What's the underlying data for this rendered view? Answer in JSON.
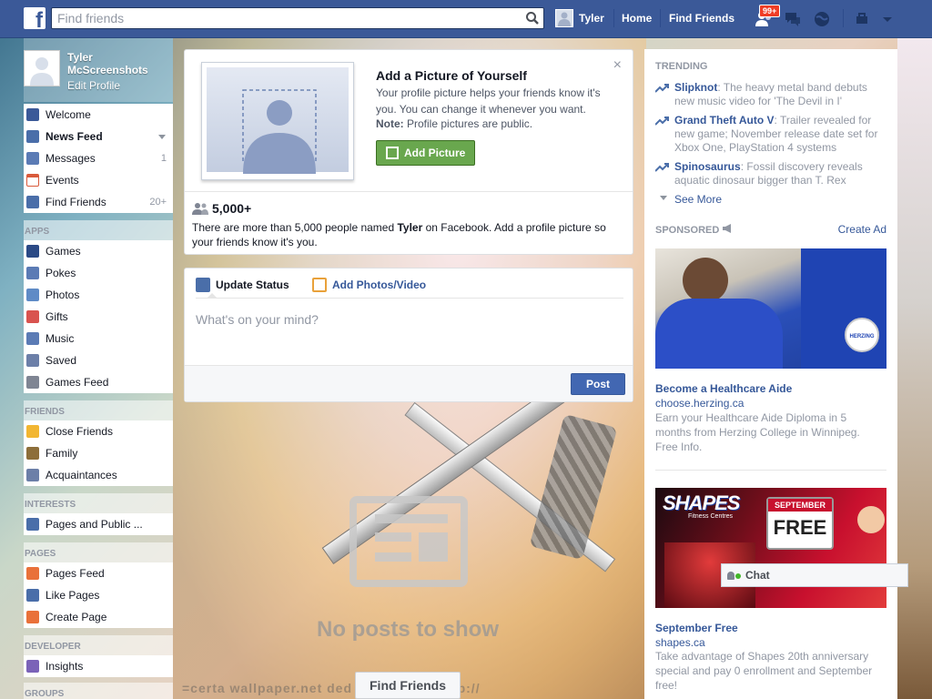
{
  "topbar": {
    "logo": "f",
    "search_placeholder": "Find friends",
    "user_name": "Tyler",
    "home": "Home",
    "find_friends": "Find Friends",
    "notification_count": "99+"
  },
  "profile": {
    "name": "Tyler McScreenshots",
    "edit": "Edit Profile"
  },
  "nav": {
    "main": [
      {
        "label": "Welcome",
        "icon": "facebook-icon",
        "color": "#3b5998"
      },
      {
        "label": "News Feed",
        "icon": "news-feed-icon",
        "color": "#4a6ea9"
      },
      {
        "label": "Messages",
        "icon": "messages-icon",
        "count": "1",
        "color": "#5b7bb5"
      },
      {
        "label": "Events",
        "icon": "calendar-icon",
        "color": "#d95a3b"
      },
      {
        "label": "Find Friends",
        "icon": "friends-icon",
        "count": "20+",
        "color": "#4a6ea9"
      }
    ],
    "apps_head": "APPS",
    "apps": [
      {
        "label": "Games",
        "icon": "games-icon",
        "color": "#2b4a86"
      },
      {
        "label": "Pokes",
        "icon": "poke-icon",
        "color": "#5b7bb5"
      },
      {
        "label": "Photos",
        "icon": "photos-icon",
        "color": "#5f8bc6"
      },
      {
        "label": "Gifts",
        "icon": "gift-icon",
        "color": "#d9534f"
      },
      {
        "label": "Music",
        "icon": "music-icon",
        "color": "#5b7bb5"
      },
      {
        "label": "Saved",
        "icon": "bookmark-icon",
        "color": "#6c7fa8"
      },
      {
        "label": "Games Feed",
        "icon": "controller-icon",
        "color": "#7f8593"
      }
    ],
    "friends_head": "FRIENDS",
    "friends": [
      {
        "label": "Close Friends",
        "icon": "star-icon",
        "color": "#f2b632"
      },
      {
        "label": "Family",
        "icon": "house-icon",
        "color": "#8d6e3a"
      },
      {
        "label": "Acquaintances",
        "icon": "acquaintances-icon",
        "color": "#6c7fa8"
      }
    ],
    "interests_head": "INTERESTS",
    "interests": [
      {
        "label": "Pages and Public ...",
        "icon": "list-icon",
        "color": "#4a6ea9"
      }
    ],
    "pages_head": "PAGES",
    "pages": [
      {
        "label": "Pages Feed",
        "icon": "megaphone-icon",
        "color": "#e9713a"
      },
      {
        "label": "Like Pages",
        "icon": "thumbs-up-icon",
        "color": "#4a6ea9"
      },
      {
        "label": "Create Page",
        "icon": "plus-icon",
        "color": "#e9713a"
      }
    ],
    "developer_head": "DEVELOPER",
    "developer": [
      {
        "label": "Insights",
        "icon": "insights-icon",
        "color": "#7b63b8"
      }
    ],
    "groups_head": "GROUPS"
  },
  "profile_prompt": {
    "title": "Add a Picture of Yourself",
    "text": "Your profile picture helps your friends know it's you. You can change it whenever you want.",
    "note_label": "Note:",
    "note_text": " Profile pictures are public.",
    "button": "Add Picture",
    "close": "×",
    "count": "5,000+",
    "desc_pre": "There are more than 5,000 people named ",
    "desc_name": "Tyler",
    "desc_post": " on Facebook. Add a profile picture so your friends know it's you."
  },
  "composer": {
    "tab_status": "Update Status",
    "tab_photos": "Add Photos/Video",
    "placeholder": "What's on your mind?",
    "post": "Post"
  },
  "feed": {
    "empty": "No posts to show",
    "find_friends": "Find Friends",
    "watermark": "=certa   wallpaper.net   ded by exoteric   http://"
  },
  "trending": {
    "head": "TRENDING",
    "items": [
      {
        "topic": "Slipknot",
        "text": ": The heavy metal band debuts new music video for 'The Devil in I'"
      },
      {
        "topic": "Grand Theft Auto V",
        "text": ": Trailer revealed for new game; November release date set for Xbox One, PlayStation 4 systems"
      },
      {
        "topic": "Spinosaurus",
        "text": ": Fossil discovery reveals aquatic dinosaur bigger than T. Rex"
      }
    ],
    "see_more": "See More"
  },
  "sponsored": {
    "head": "SPONSORED",
    "create_ad": "Create Ad",
    "ads": [
      {
        "title": "Become a Healthcare Aide",
        "domain": "choose.herzing.ca",
        "body": "Earn your Healthcare Aide Diploma in 5 months from Herzing College in Winnipeg. Free Info.",
        "badge": "HERZING"
      },
      {
        "title": "September Free",
        "domain": "shapes.ca",
        "body": "Take advantage of Shapes 20th anniversary special and pay 0 enrollment and September free!",
        "brand": "SHAPES",
        "brand_sub": "Fitness Centres",
        "banner_top": "SEPTEMBER",
        "banner_main": "FREE"
      }
    ]
  },
  "chat": {
    "label": "Chat"
  }
}
